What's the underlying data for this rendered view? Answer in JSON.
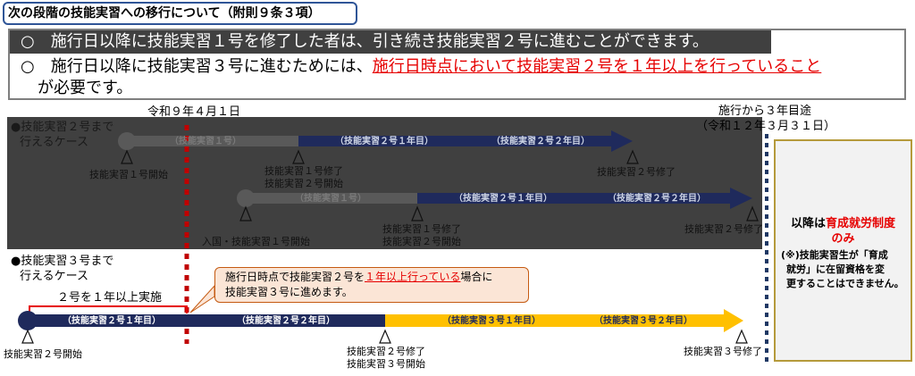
{
  "title": "次の段階の技能実習への移行について（附則９条３項）",
  "intro": {
    "line1": "○　施行日以降に技能実習１号を修了した者は、引き続き技能実習２号に進むことができます。",
    "line2_prefix": "○　施行日以降に技能実習３号に進むためには、",
    "line2_highlight": "施行日時点において技能実習２号を１年以上を行っていること",
    "line3": "が必要です。"
  },
  "dates": {
    "effective": "令和９年４月１日",
    "end_line1": "施行から３年目途",
    "end_line2": "（令和１２年３月３１日）"
  },
  "case1": {
    "heading_line1": "●技能実習２号まで",
    "heading_line2": "行えるケース",
    "row1": {
      "seg1": "（技能実習１号）",
      "seg2": "（技能実習２号１年目）",
      "seg3": "（技能実習２号２年目）",
      "m1": "技能実習１号開始",
      "m2_line1": "技能実習１号修了",
      "m2_line2": "技能実習２号開始",
      "m3": "技能実習２号修了"
    },
    "row2": {
      "seg1": "（技能実習１号）",
      "seg2": "（技能実習２号１年目）",
      "seg3": "（技能実習２号２年目）",
      "m1": "入国・技能実習１号開始",
      "m2_line1": "技能実習１号修了",
      "m2_line2": "技能実習２号開始",
      "m3": "技能実習２号修了"
    }
  },
  "case2": {
    "heading_line1": "●技能実習３号まで",
    "heading_line2": "行えるケース",
    "bracket": "２号を１年以上実施",
    "seg1": "（技能実習２号１年目）",
    "seg2": "（技能実習２号２年目）",
    "seg3": "（技能実習３号１年目）",
    "seg4": "（技能実習３号２年目）",
    "m1": "技能実習２号開始",
    "m2_line1": "技能実習２号修了",
    "m2_line2": "技能実習３号開始",
    "m3": "技能実習３号修了"
  },
  "callout": {
    "prefix": "施行日時点で技能実習２号を",
    "highlight": "１年以上行っている",
    "suffix": "場合に",
    "line2": "技能実習３号に進めます。"
  },
  "side": {
    "line1_prefix": "以降は",
    "line1_highlight": "育成就労制度",
    "line2_highlight": "のみ",
    "note_line1": "(※)技能実習生が「育成",
    "note_line2": "就労」に在留資格を変",
    "note_line3": "更することはできません。"
  },
  "colors": {
    "navy": "#1f2a5c",
    "gold": "#ffc000",
    "red": "#e60000",
    "dark_bg": "#404040",
    "title_border": "#2f5597",
    "side_border": "#b59a3b"
  }
}
